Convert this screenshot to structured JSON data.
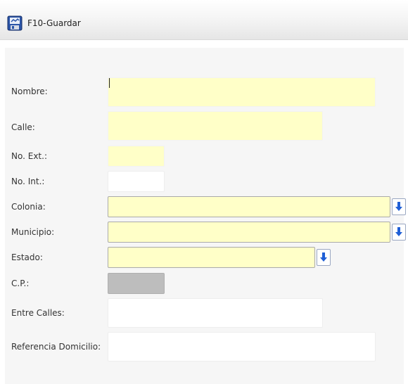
{
  "toolbar": {
    "save_label": "F10-Guardar",
    "save_icon": "save-disk-icon"
  },
  "form": {
    "fields": {
      "nombre": {
        "label": "Nombre:",
        "value": ""
      },
      "calle": {
        "label": "Calle:",
        "value": ""
      },
      "no_ext": {
        "label": "No. Ext.:",
        "value": ""
      },
      "no_int": {
        "label": "No. Int.:",
        "value": ""
      },
      "colonia": {
        "label": "Colonia:",
        "value": ""
      },
      "municipio": {
        "label": "Municipio:",
        "value": ""
      },
      "estado": {
        "label": "Estado:",
        "value": ""
      },
      "cp": {
        "label": "C.P.:",
        "value": ""
      },
      "entre_calles": {
        "label": "Entre Calles:",
        "value": ""
      },
      "referencia": {
        "label": "Referencia Domicilio:",
        "value": ""
      }
    },
    "dropdown_icon": "arrow-down-icon"
  },
  "colors": {
    "required_field": "#ffffc8",
    "disabled_field": "#bdbdbd",
    "accent": "#1f5fd6"
  }
}
